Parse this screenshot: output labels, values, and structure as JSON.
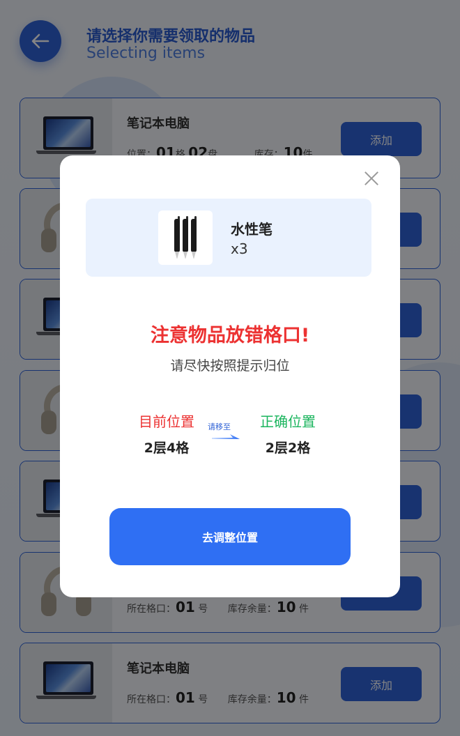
{
  "header": {
    "title": "请选择你需要领取的物品",
    "subtitle": "Selecting items",
    "back_icon": "arrow-left-icon"
  },
  "items": [
    {
      "name": "笔记本电脑",
      "image": "laptop-icon",
      "meta": {
        "label_a": "位置：",
        "val_a1": "01",
        "unit_a1": "格",
        "val_a2": "02",
        "unit_a2": "盘",
        "label_b": "库存：",
        "val_b": "10",
        "unit_b": "件"
      },
      "button": "添加"
    },
    {
      "name": "",
      "image": "headphone-icon",
      "button": ""
    },
    {
      "name": "",
      "image": "laptop-icon",
      "button": ""
    },
    {
      "name": "",
      "image": "headphone-icon",
      "button": ""
    },
    {
      "name": "",
      "image": "laptop-icon",
      "button": ""
    },
    {
      "name": "",
      "image": "headphone-icon",
      "meta": {
        "label_a": "所在格口：",
        "val_a1": "01",
        "unit_a1": "号",
        "label_b": "库存余量：",
        "val_b": "10",
        "unit_b": "件"
      },
      "button": ""
    },
    {
      "name": "笔记本电脑",
      "image": "laptop-icon",
      "meta": {
        "label_a": "所在格口：",
        "val_a1": "01",
        "unit_a1": "号",
        "label_b": "库存余量：",
        "val_b": "10",
        "unit_b": "件"
      },
      "button": "添加"
    }
  ],
  "modal": {
    "product_name": "水性笔",
    "product_qty": "x3",
    "product_image": "pens-icon",
    "warning": "注意物品放错格口!",
    "hint": "请尽快按照提示归位",
    "current_label": "目前位置",
    "current_value": "2层4格",
    "move_label": "请移至",
    "correct_label": "正确位置",
    "correct_value": "2层2格",
    "action_button": "去调整位置",
    "close_icon": "close-icon"
  },
  "colors": {
    "primary": "#2f62d6",
    "button_blue": "#2f6ff3",
    "warning_red": "#ec3232",
    "success_green": "#1bb55e",
    "product_box_bg": "#eaf2fe"
  }
}
